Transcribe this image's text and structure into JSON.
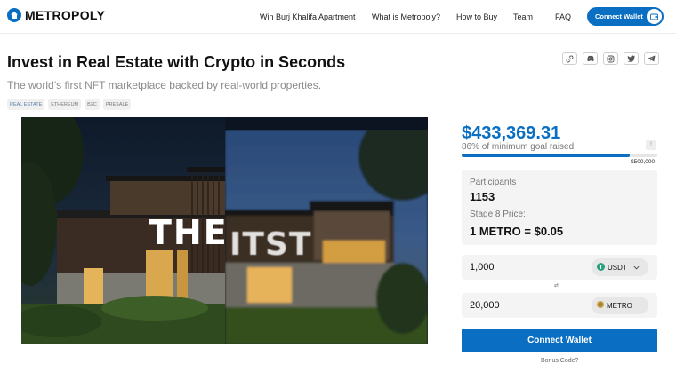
{
  "brand": {
    "name": "METROPOLY",
    "accent": "#0a6fc2"
  },
  "nav": {
    "items": [
      "Win Burj Khalifa Apartment",
      "What is Metropoly?",
      "How to Buy",
      "Team",
      "FAQ"
    ],
    "connect_label": "Connect Wallet"
  },
  "hero": {
    "title": "Invest in Real Estate with Crypto in Seconds",
    "subtitle": "The world’s first NFT marketplace backed by real-world properties.",
    "tags": [
      "REAL ESTATE",
      "ETHEREUM",
      "B2C",
      "PRESALE"
    ],
    "image_text_left": "THE F",
    "image_text_right": "ITST"
  },
  "socials": [
    "link-icon",
    "discord-icon",
    "instagram-icon",
    "twitter-icon",
    "telegram-icon"
  ],
  "sale": {
    "amount_raised": "$433,369.31",
    "goal_text": "86% of minimum goal raised",
    "goal_progress": 0.86,
    "goal_max": "$500,000",
    "participants_label": "Participants",
    "participants_value": "1153",
    "stage_label": "Stage 8 Price:",
    "stage_price": "1 METRO = $0.05",
    "pay_amount": "1,000",
    "pay_currency": "USDT",
    "receive_amount": "20,000",
    "receive_currency": "METRO",
    "swap_symbol": "⇄",
    "connect_label": "Connect Wallet",
    "bonus_label": "Bonus Code?"
  }
}
